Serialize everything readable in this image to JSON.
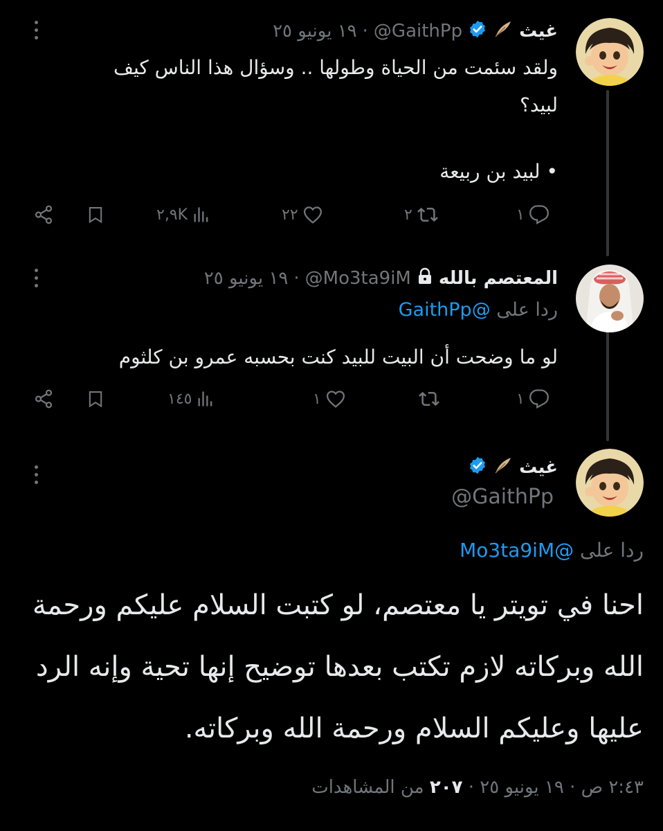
{
  "tweet1": {
    "name": "غيث",
    "handle": "@GaithPp",
    "date": "١٩ يونيو ٢٥",
    "text_line1": "ولقد سئمت من الحياة وطولها .. وسؤال هذا الناس كيف",
    "text_line2": "لبيد؟",
    "text_line3": "• لبيد بن ربيعة",
    "replies": "١",
    "retweets": "٢",
    "likes": "٢٢",
    "views": "٢,٩K"
  },
  "tweet2": {
    "name": "المعتصم بالله",
    "handle": "@Mo3ta9iM",
    "date": "١٩ يونيو ٢٥",
    "reply_prefix": "ردا على",
    "reply_mention": "@GaithPp",
    "text": "لو ما وضحت أن البيت للبيد كنت بحسبه عمرو بن كلثوم",
    "replies": "١",
    "retweets": "",
    "likes": "١",
    "views": "١٤٥"
  },
  "tweet3": {
    "name": "غيث",
    "handle": "@GaithPp",
    "reply_prefix": "ردا على",
    "reply_mention": "@Mo3ta9iM",
    "text_line1": "احنا في تويتر يا معتصم، لو كتبت السلام عليكم ورحمة",
    "text_line2": "الله وبركاته لازم تكتب بعدها توضيح إنها تحية وإنه الرد",
    "text_line3": "عليها وعليكم السلام ورحمة الله وبركاته.",
    "time": "٢:٤٣ ص",
    "date": "١٩ يونيو ٢٥",
    "views_count": "٢٠٧",
    "views_label": "من المشاهدات"
  },
  "separator": "·",
  "colors": {
    "accent": "#1d9bf0",
    "muted": "#71767b",
    "text": "#e7e9ea",
    "background": "#000000"
  },
  "icons": [
    "more-icon",
    "verified-badge-icon",
    "feather-icon",
    "lock-icon",
    "reply-icon",
    "retweet-icon",
    "like-icon",
    "views-icon",
    "bookmark-icon",
    "share-icon"
  ]
}
